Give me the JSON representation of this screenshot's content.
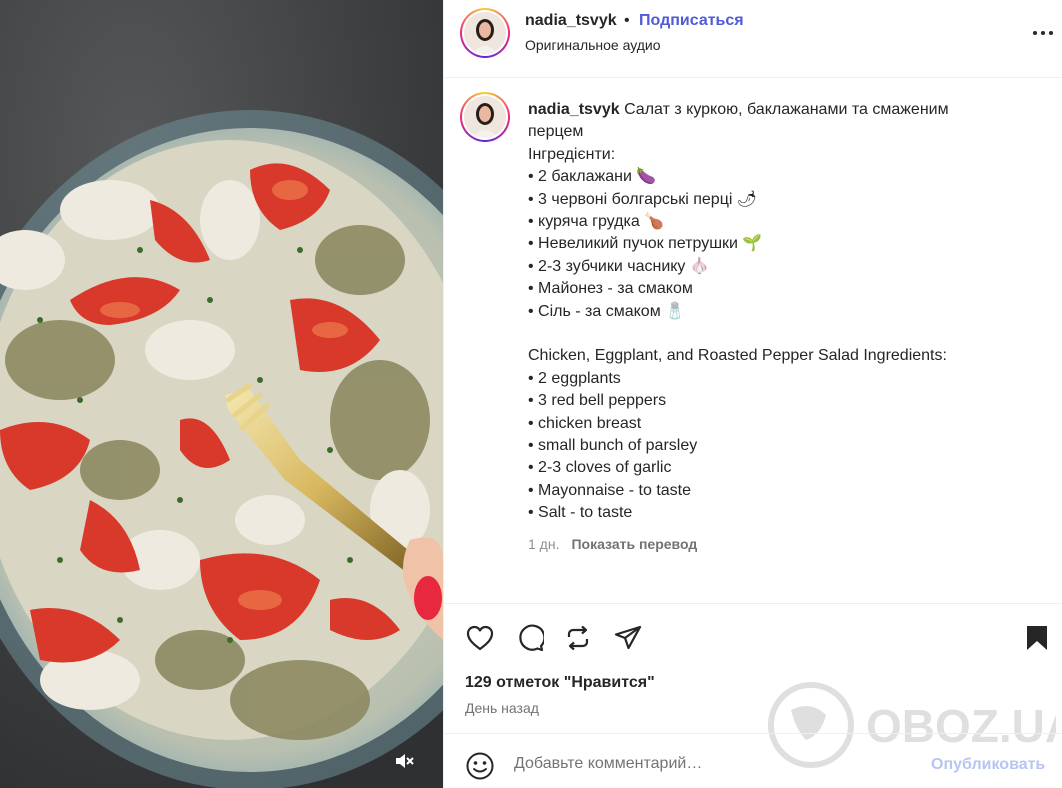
{
  "header": {
    "username": "nadia_tsvyk",
    "dot": "•",
    "follow_label": "Подписаться",
    "audio_label": "Оригинальное аудио",
    "avatar_icon": "profile-photo",
    "more_icon": "more-horizontal-icon"
  },
  "caption": {
    "username": "nadia_tsvyk",
    "lines": [
      "Салат з куркою, баклажанами та смаженим",
      "перцем",
      "Інгредієнти:",
      "• 2 баклажани 🍆",
      "• 3 червоні болгарські перці 🌶",
      "• куряча грудка 🍗",
      "• Невеликий пучок петрушки 🌱",
      "• 2-3 зубчики часнику 🧄",
      "• Майонез - за смаком",
      "• Сіль - за смаком 🧂",
      "",
      "Chicken, Eggplant, and Roasted Pepper Salad Ingredients:",
      "• 2 eggplants",
      "• 3 red bell peppers",
      "• chicken breast",
      "• small bunch of parsley",
      "• 2-3 cloves of garlic",
      "• Mayonnaise - to taste",
      "• Salt - to taste"
    ],
    "time": "1 дн.",
    "translate_label": "Показать перевод"
  },
  "actions": {
    "like_icon": "heart-icon",
    "comment_icon": "comment-icon",
    "repost_icon": "repost-icon",
    "share_icon": "send-icon",
    "save_icon": "bookmark-icon",
    "likes_text": "129 отметок \"Нравится\"",
    "ago_text": "День назад"
  },
  "comment": {
    "placeholder": "Добавьте комментарий…",
    "post_label": "Опубликовать",
    "emoji_icon": "smiley-icon"
  },
  "media": {
    "mute_icon": "muted-speaker-icon"
  },
  "watermark": {
    "text": "OBOZ.UA"
  },
  "colors": {
    "accent": "#4f5bd5",
    "post_disabled": "#b6c5f2",
    "text": "#262626",
    "muted": "#737373"
  }
}
